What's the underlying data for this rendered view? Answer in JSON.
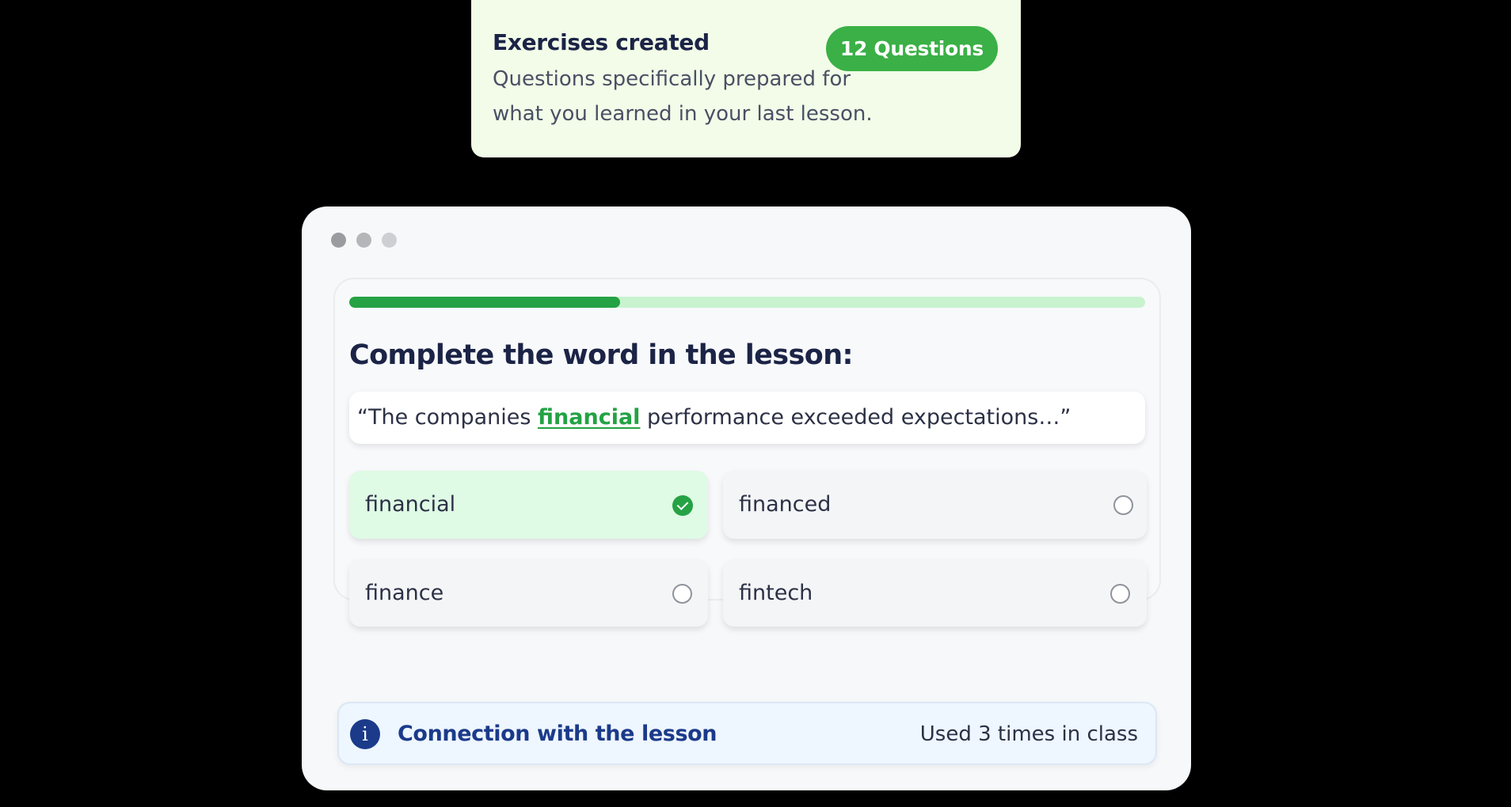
{
  "notice": {
    "title": "Exercises created",
    "description": "Questions specifically prepared for what you learned in your last lesson.",
    "badge": "12 Questions"
  },
  "quiz": {
    "progress": 0.34,
    "question": "Complete the word in the lesson:",
    "sentence": {
      "before": "“The companies ",
      "highlight": "financial",
      "after": " performance exceeded expectations…”"
    },
    "options": [
      {
        "label": "financial",
        "selected": true
      },
      {
        "label": "financed",
        "selected": false
      },
      {
        "label": "finance",
        "selected": false
      },
      {
        "label": "fintech",
        "selected": false
      }
    ]
  },
  "connection": {
    "icon": "info-icon",
    "label": "Connection with the lesson",
    "usage": "Used 3 times in class"
  },
  "colors": {
    "accent_green": "#24a244",
    "badge_green": "#3ab046",
    "navy": "#1b2446",
    "info_blue": "#1b3a8a"
  }
}
